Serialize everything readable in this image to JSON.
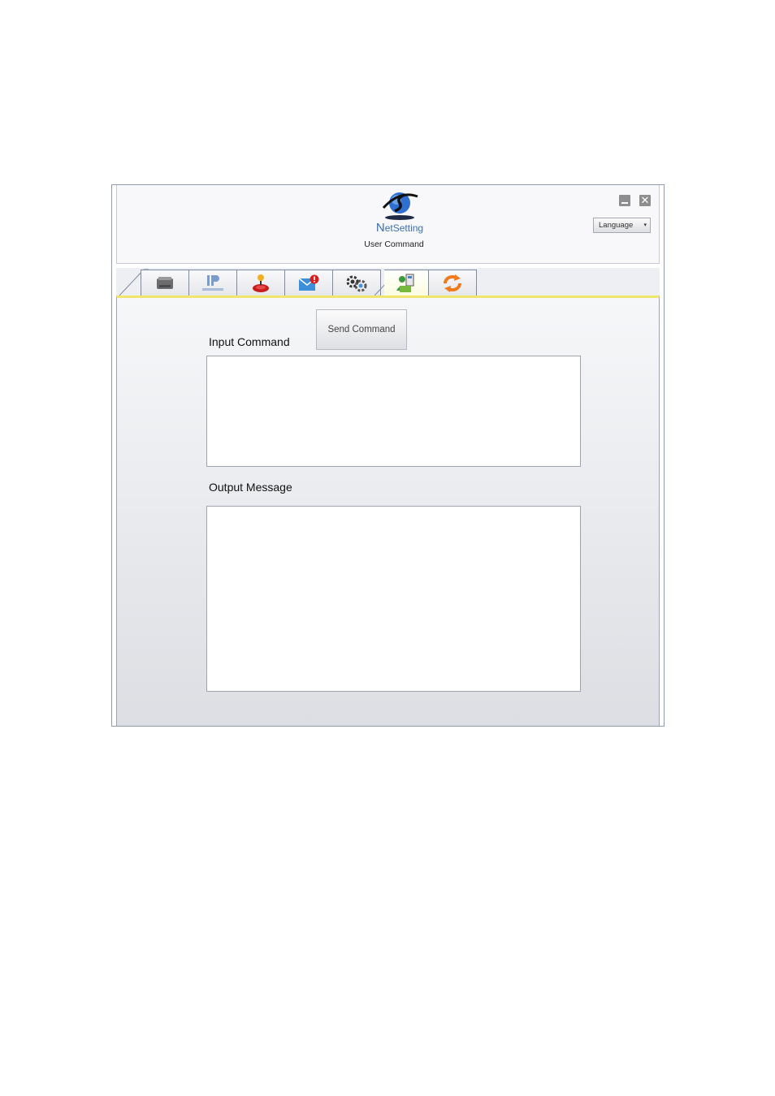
{
  "header": {
    "logo_text_first": "N",
    "logo_text_rest": "etSetting",
    "subtitle": "User Command",
    "language_select": "Language",
    "language_arrow": "▾",
    "close_glyph": "✕"
  },
  "tabs": [
    {
      "icon": "printer-icon",
      "active": false
    },
    {
      "icon": "ip-network-icon",
      "active": false
    },
    {
      "icon": "joystick-icon",
      "active": false
    },
    {
      "icon": "alert-mail-icon",
      "active": false
    },
    {
      "icon": "gears-icon",
      "active": false
    },
    {
      "icon": "user-command-icon",
      "active": true
    },
    {
      "icon": "refresh-icon",
      "active": false
    }
  ],
  "main": {
    "send_button": "Send Command",
    "input_label": "Input Command",
    "input_value": "",
    "output_label": "Output Message",
    "output_value": ""
  },
  "colors": {
    "active_tab_underline": "#f0e66c",
    "logo_blue": "#3a6fb3",
    "refresh_orange": "#f07a1a"
  }
}
